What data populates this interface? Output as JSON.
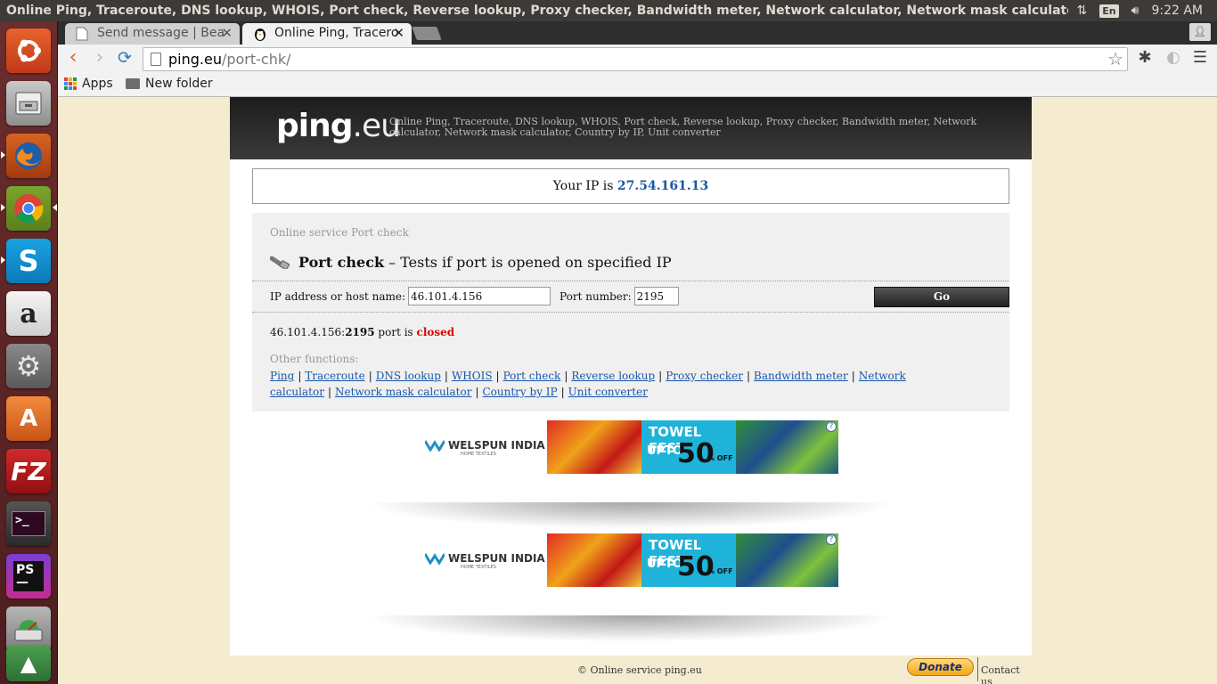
{
  "topbar": {
    "title": "Online Ping, Traceroute, DNS lookup, WHOIS, Port check, Reverse lookup, Proxy checker, Bandwidth meter, Network calculator, Network mask calculator, Country",
    "lang": "En",
    "time": "9:22 AM"
  },
  "tabs": [
    {
      "label": "Send message | Bea"
    },
    {
      "label": "Online Ping, Tracero"
    }
  ],
  "address": {
    "host": "ping.eu",
    "path": "/port-chk/"
  },
  "bookmarks": {
    "apps": "Apps",
    "folder": "New folder"
  },
  "site": {
    "logo_a": "ping",
    "logo_b": ".eu",
    "tagline": "Online Ping, Traceroute, DNS lookup, WHOIS, Port check, Reverse lookup, Proxy checker, Bandwidth meter, Network calculator, Network mask calculator, Country by IP, Unit converter",
    "your_ip_label": "Your IP is",
    "your_ip": "27.54.161.13",
    "service_label": "Online service Port check",
    "heading_bold": "Port check",
    "heading_rest": " – Tests if port is opened on specified IP",
    "host_label": "IP address or host name:",
    "host_value": "46.101.4.156",
    "port_label": "Port number:",
    "port_value": "2195",
    "go_label": "Go",
    "result_ip": "46.101.4.156:",
    "result_port": "2195",
    "result_mid": " port is ",
    "result_status": "closed",
    "other_label": "Other functions:",
    "links": [
      "Ping",
      "Traceroute",
      "DNS lookup",
      "WHOIS",
      "Port check",
      "Reverse lookup",
      "Proxy checker",
      "Bandwidth meter",
      "Network calculator",
      "Network mask calculator",
      "Country by IP",
      "Unit converter"
    ]
  },
  "ad": {
    "brand": "WELSPUN INDIA",
    "brand_sub": "HOME TEXTILES",
    "promo_title": "TOWEL FEST",
    "promo_upto": "UPTO",
    "promo_pct": "50",
    "promo_off": "% OFF",
    "help": "?"
  },
  "footer": {
    "copyright": "© Online service ping.eu",
    "donate": "Donate",
    "contact": "Contact us"
  },
  "colors": {
    "link": "#1a57a9",
    "closed": "#dd0000",
    "launcher": "#5a2325"
  }
}
